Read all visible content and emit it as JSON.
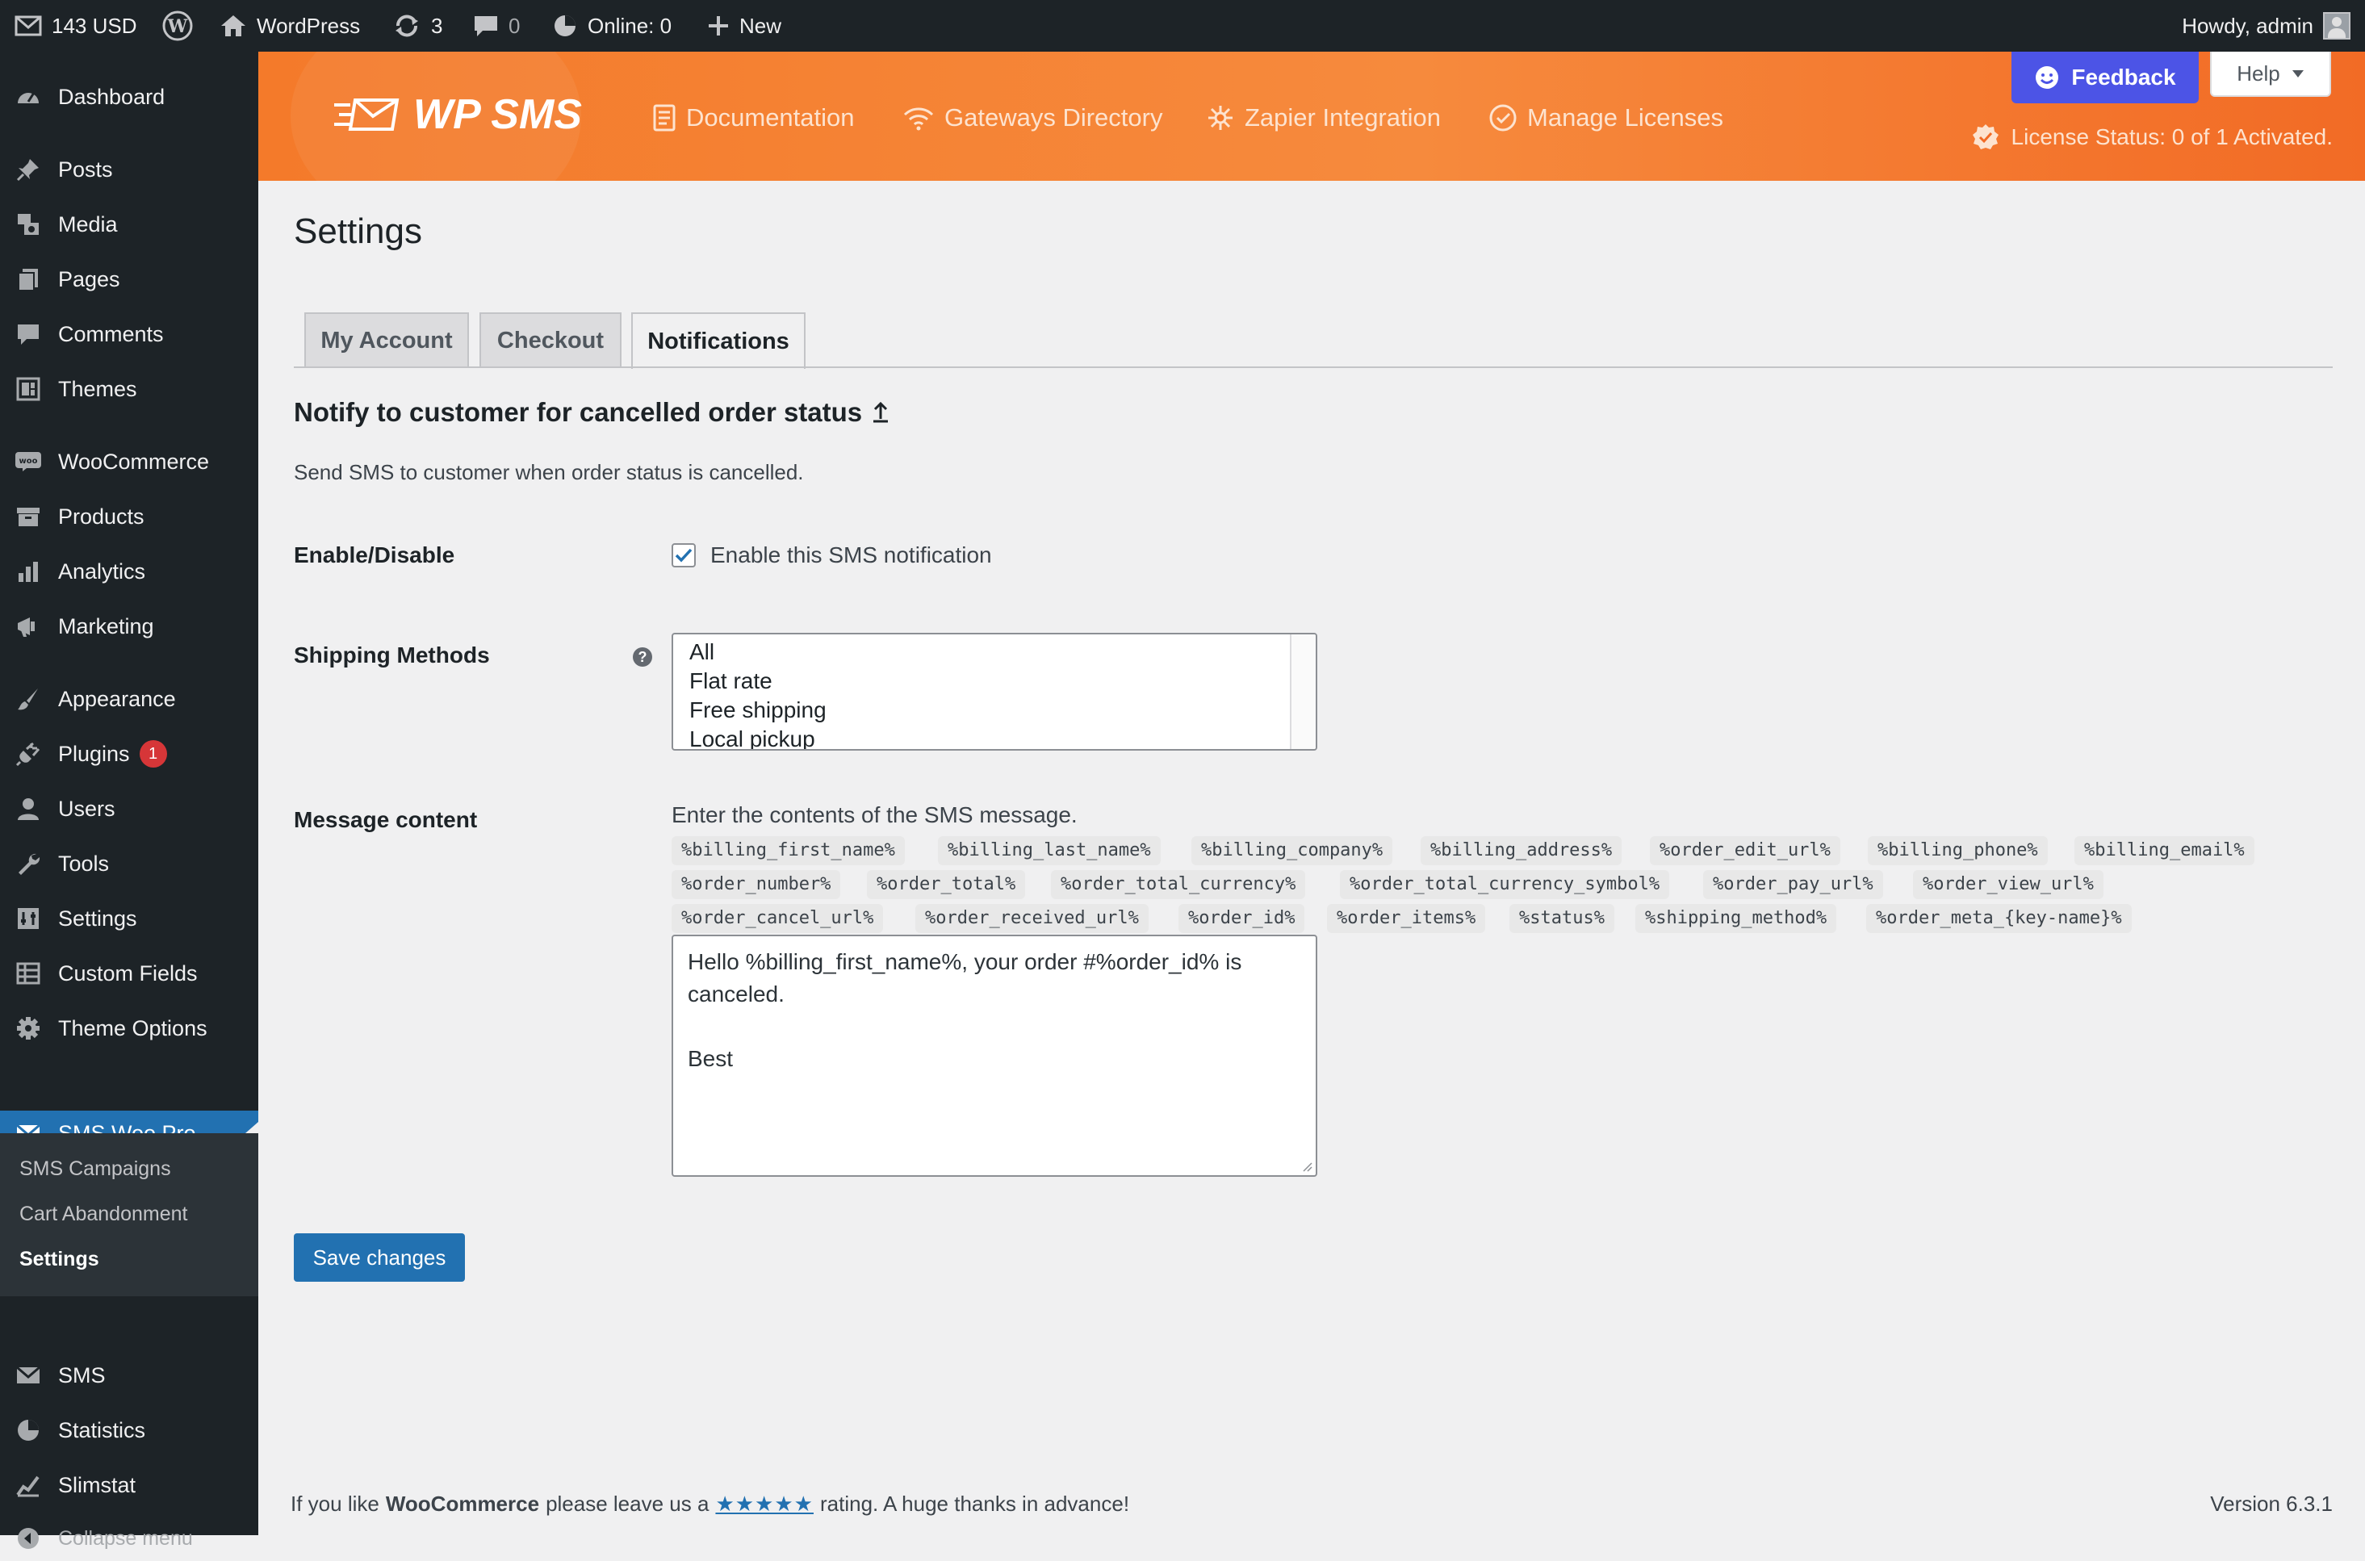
{
  "adminbar": {
    "balance": "143 USD",
    "site": "WordPress",
    "updates": "3",
    "comments": "0",
    "online": "Online: 0",
    "new": "New",
    "howdy": "Howdy, admin"
  },
  "sidebar": {
    "items": [
      {
        "label": "Dashboard",
        "icon": "dashboard-icon"
      },
      {
        "label": "Posts",
        "icon": "pin-icon"
      },
      {
        "label": "Media",
        "icon": "media-icon"
      },
      {
        "label": "Pages",
        "icon": "pages-icon"
      },
      {
        "label": "Comments",
        "icon": "comment-icon"
      },
      {
        "label": "Themes",
        "icon": "themes-icon"
      },
      {
        "label": "WooCommerce",
        "icon": "woo-icon"
      },
      {
        "label": "Products",
        "icon": "archive-icon"
      },
      {
        "label": "Analytics",
        "icon": "chart-bar-icon"
      },
      {
        "label": "Marketing",
        "icon": "megaphone-icon"
      },
      {
        "label": "Appearance",
        "icon": "brush-icon"
      },
      {
        "label": "Plugins",
        "icon": "plug-icon",
        "badge": "1"
      },
      {
        "label": "Users",
        "icon": "user-icon"
      },
      {
        "label": "Tools",
        "icon": "wrench-icon"
      },
      {
        "label": "Settings",
        "icon": "settings-icon"
      },
      {
        "label": "Custom Fields",
        "icon": "table-icon"
      },
      {
        "label": "Theme Options",
        "icon": "gear-icon"
      },
      {
        "label": "SMS Woo Pro",
        "icon": "envelope-icon"
      },
      {
        "label": "SMS",
        "icon": "envelope-icon"
      },
      {
        "label": "Statistics",
        "icon": "pie-icon"
      },
      {
        "label": "Slimstat",
        "icon": "trend-icon"
      }
    ],
    "submenu": [
      "SMS Campaigns",
      "Cart Abandonment",
      "Settings"
    ],
    "collapse": "Collapse menu"
  },
  "banner": {
    "logo": "WP SMS",
    "links": [
      "Documentation",
      "Gateways Directory",
      "Zapier Integration",
      "Manage Licenses"
    ],
    "feedback": "Feedback",
    "help": "Help",
    "license": "License Status: 0 of 1 Activated."
  },
  "page": {
    "title": "Settings",
    "tabs": [
      "My Account",
      "Checkout",
      "Notifications"
    ],
    "section_title": "Notify to customer for cancelled order status",
    "section_desc": "Send SMS to customer when order status is cancelled.",
    "enable_label": "Enable/Disable",
    "enable_checkbox": "Enable this SMS notification",
    "shipping_label": "Shipping Methods",
    "shipping_options": [
      "All",
      "Flat rate",
      "Free shipping",
      "Local pickup"
    ],
    "message_label": "Message content",
    "message_intro": "Enter the contents of the SMS message.",
    "tags": [
      "%billing_first_name%",
      "%billing_last_name%",
      "%billing_company%",
      "%billing_address%",
      "%order_edit_url%",
      "%billing_phone%",
      "%billing_email%",
      "%order_number%",
      "%order_total%",
      "%order_total_currency%",
      "%order_total_currency_symbol%",
      "%order_pay_url%",
      "%order_view_url%",
      "%order_cancel_url%",
      "%order_received_url%",
      "%order_id%",
      "%order_items%",
      "%status%",
      "%shipping_method%",
      "%order_meta_{key-name}%"
    ],
    "message_value": "Hello %billing_first_name%, your order #%order_id% is\ncanceled.\n\nBest",
    "save": "Save changes"
  },
  "footer": {
    "prefix": "If you like",
    "brand": "WooCommerce",
    "middle": "please leave us a",
    "stars": "★★★★★",
    "suffix": "rating. A huge thanks in advance!",
    "version": "Version 6.3.1"
  }
}
